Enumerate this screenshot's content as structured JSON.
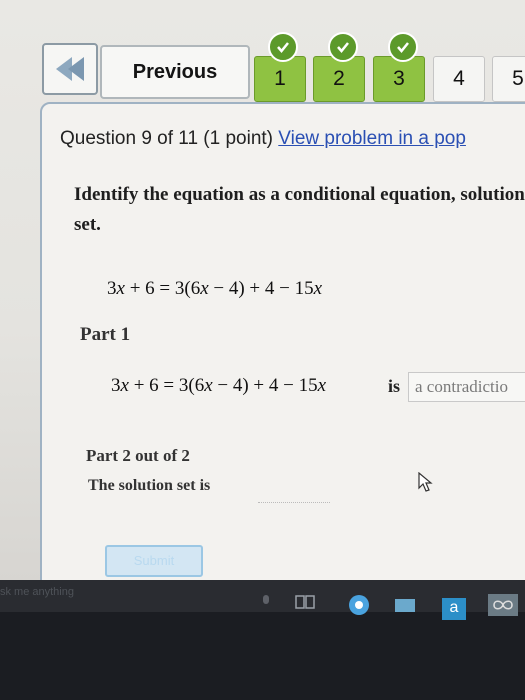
{
  "nav": {
    "previous_label": "Previous",
    "questions": [
      {
        "number": "1",
        "done": true
      },
      {
        "number": "2",
        "done": true
      },
      {
        "number": "3",
        "done": true
      },
      {
        "number": "4",
        "done": false
      },
      {
        "number": "5",
        "done": false
      }
    ]
  },
  "question": {
    "header": "Question 9 of 11 (1 point)",
    "link": "View problem in a pop",
    "prompt": "Identify the equation as a conditional equation, solution set."
  },
  "equation": {
    "lhs_a": "3",
    "lhs_var": "x",
    "lhs_b": " + 6 = 3(6",
    "rhs_var": "x",
    "rhs_b": " − 4) + 4 − 15",
    "rhs_var2": "x"
  },
  "part1": {
    "label": "Part 1",
    "is_word": "is",
    "answer": "a contradictio"
  },
  "part2": {
    "label": "Part 2 out of 2",
    "solution_label": "The solution set is"
  },
  "submit_label": "Submit",
  "taskbar": {
    "ask_text": "sk me anything",
    "store_letter": "a"
  },
  "colors": {
    "done_green": "#8fc242",
    "link_blue": "#2a4fb3",
    "panel_border": "#9fb2c3"
  }
}
